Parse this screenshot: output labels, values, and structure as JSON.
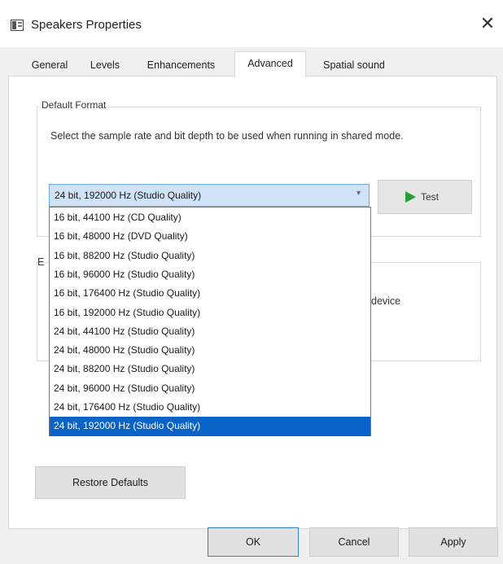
{
  "window": {
    "title": "Speakers Properties",
    "close_glyph": "✕"
  },
  "tabs": [
    {
      "label": "General"
    },
    {
      "label": "Levels"
    },
    {
      "label": "Enhancements"
    },
    {
      "label": "Advanced",
      "active": true
    },
    {
      "label": "Spatial sound"
    }
  ],
  "default_format": {
    "group_label": "Default Format",
    "description": "Select the sample rate and bit depth to be used when running in shared mode.",
    "selected_value": "24 bit, 192000 Hz (Studio Quality)",
    "test_label": "Test"
  },
  "exclusive_partial": {
    "group_label_fragment": "E",
    "text_fragment": "device"
  },
  "dropdown_options": [
    "16 bit, 44100 Hz (CD Quality)",
    "16 bit, 48000 Hz (DVD Quality)",
    "16 bit, 88200 Hz (Studio Quality)",
    "16 bit, 96000 Hz (Studio Quality)",
    "16 bit, 176400 Hz (Studio Quality)",
    "16 bit, 192000 Hz (Studio Quality)",
    "24 bit, 44100 Hz (Studio Quality)",
    "24 bit, 48000 Hz (Studio Quality)",
    "24 bit, 88200 Hz (Studio Quality)",
    "24 bit, 96000 Hz (Studio Quality)",
    "24 bit, 176400 Hz (Studio Quality)",
    "24 bit, 192000 Hz (Studio Quality)"
  ],
  "selected_option_index": 11,
  "buttons": {
    "restore_defaults": "Restore Defaults",
    "ok": "OK",
    "cancel": "Cancel",
    "apply": "Apply"
  },
  "colors": {
    "selection_highlight": "#0a64c8",
    "test_play_icon": "#2a9d3a"
  },
  "icons": {
    "window": "speaker-properties-icon",
    "dropdown": "chevron-down-icon",
    "test": "play-icon"
  }
}
